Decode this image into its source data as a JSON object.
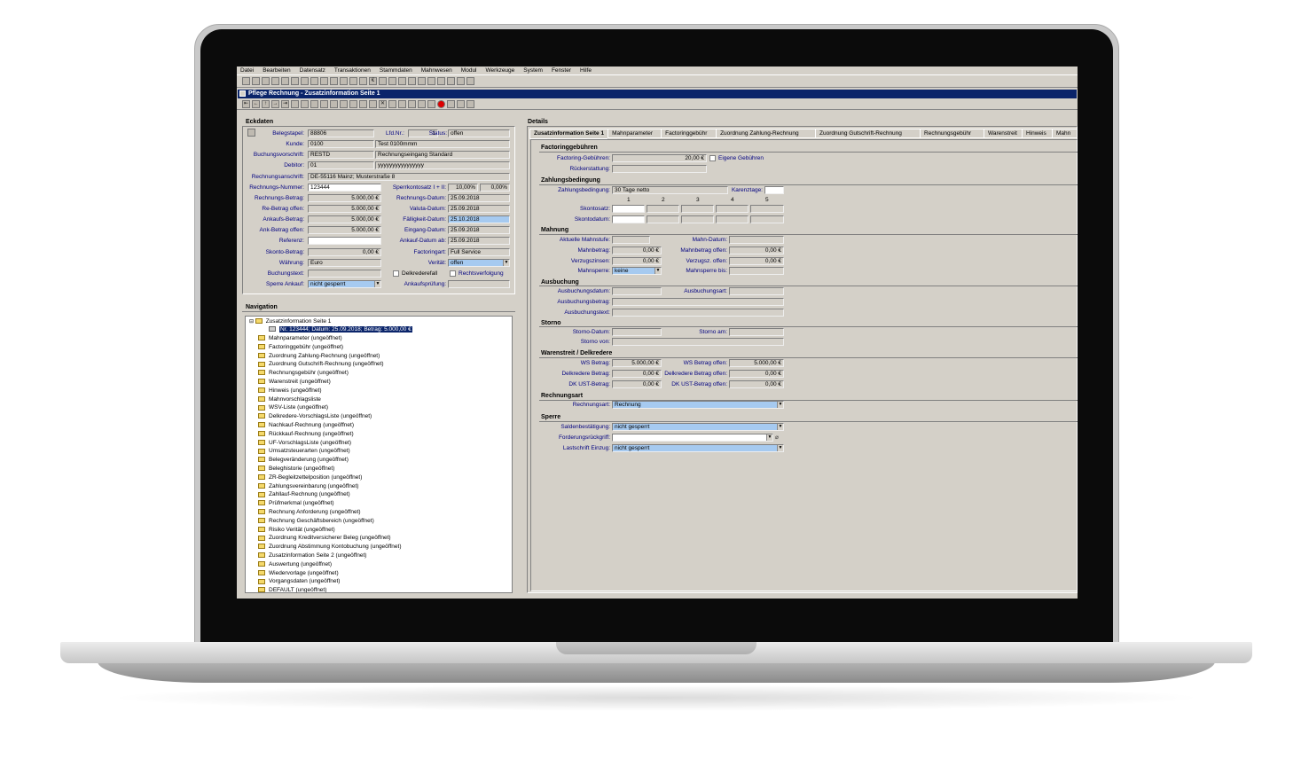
{
  "menu": [
    "Datei",
    "Bearbeiten",
    "Datensatz",
    "Transaktionen",
    "Stammdaten",
    "Mahnwesen",
    "Modul",
    "Werkzeuge",
    "System",
    "Fenster",
    "Hilfe"
  ],
  "window_title": "Pflege Rechnung - Zusatzinformation Seite 1",
  "eckdaten": {
    "title": "Eckdaten",
    "belegstapel_label": "Belegstapel:",
    "belegstapel": "88806",
    "lfdnr_label": "Lfd.Nr.:",
    "lfdnr": "1",
    "status_label": "Status:",
    "status": "offen",
    "kunde_label": "Kunde:",
    "kunde": "0100",
    "kunde_name": "Test 0100mmm",
    "buchungsvorschrift_label": "Buchungsvorschrift:",
    "buchungsvorschrift": "RESTD",
    "buchungsvorschrift_text": "Rechnungseingang Standard",
    "debitor_label": "Debitor:",
    "debitor": "01",
    "debitor_name": "yyyyyyyyyyyyyyyy",
    "anschrift_label": "Rechnungsanschrift:",
    "anschrift": "DE-55116 Mainz; Musterstraße 8",
    "rechnungsnummer_label": "Rechnungs-Nummer:",
    "rechnungsnummer": "123444",
    "sperrkontosatz_label": "Sperrkontosatz I + II:",
    "sperr1": "10,00%",
    "sperr2": "0,00%",
    "rechnungsbetrag_label": "Rechnungs-Betrag:",
    "rechnungsbetrag": "5.000,00 €",
    "rechnungsdatum_label": "Rechnungs-Datum:",
    "rechnungsdatum": "25.09.2018",
    "rebetrag_offen_label": "Re-Betrag offen:",
    "rebetrag_offen": "5.000,00 €",
    "valuta_label": "Valuta-Datum:",
    "valuta": "25.09.2018",
    "ankaufsbetrag_label": "Ankaufs-Betrag:",
    "ankaufsbetrag": "5.000,00 €",
    "faelligkeit_label": "Fälligkeit-Datum:",
    "faelligkeit": "25.10.2018",
    "ankbetrag_offen_label": "Ank-Betrag offen:",
    "ankbetrag_offen": "5.000,00 €",
    "eingang_label": "Eingang-Datum:",
    "eingang": "25.09.2018",
    "referenz_label": "Referenz:",
    "referenz": "",
    "ankaufdatum_label": "Ankauf-Datum ab:",
    "ankaufdatum": "25.09.2018",
    "skonto_label": "Skonto-Betrag:",
    "skonto": "0,00 €",
    "factoringart_label": "Factoringart:",
    "factoringart": "Full Service",
    "waehrung_label": "Währung:",
    "waehrung": "Euro",
    "veritaet_label": "Verität:",
    "veritaet": "offen",
    "buchungstext_label": "Buchungstext:",
    "buchungstext": "",
    "delkrederefall_label": "Delkrederefall",
    "rechtsverfolgung_label": "Rechtsverfolgung",
    "sperre_ankauf_label": "Sperre Ankauf:",
    "sperre_ankauf": "nicht gesperrt",
    "ankaufspruefung_label": "Ankaufsprüfung:",
    "ankaufspruefung": ""
  },
  "navigation": {
    "title": "Navigation",
    "root": "Zusatzinformation Seite 1",
    "selected": "Nr. 123444; Datum: 25.09.2018; Betrag: 5.000,00 €",
    "items": [
      "Mahnparameter (ungeöffnet)",
      "Factoringgebühr (ungeöffnet)",
      "Zuordnung Zahlung-Rechnung (ungeöffnet)",
      "Zuordnung Gutschrift-Rechnung (ungeöffnet)",
      "Rechnungsgebühr (ungeöffnet)",
      "Warenstreit (ungeöffnet)",
      "Hinweis (ungeöffnet)",
      "Mahnvorschlagsliste",
      "WSV-Liste (ungeöffnet)",
      "Delkredere-VorschlagsListe (ungeöffnet)",
      "Nachkauf-Rechnung (ungeöffnet)",
      "Rückkauf-Rechnung (ungeöffnet)",
      "UF-VorschlagsListe (ungeöffnet)",
      "Umsatzsteuerarten (ungeöffnet)",
      "Belegveränderung (ungeöffnet)",
      "Beleghistorie (ungeöffnet)",
      "ZR-Begleitzettelposition (ungeöffnet)",
      "Zahlungsvereinbarung (ungeöffnet)",
      "Zahllauf-Rechnung (ungeöffnet)",
      "Prüfmerkmal (ungeöffnet)",
      "Rechnung Anforderung (ungeöffnet)",
      "Rechnung Geschäftsbereich (ungeöffnet)",
      "Risiko Verität (ungeöffnet)",
      "Zuordnung Kreditversicherer Beleg (ungeöffnet)",
      "Zuordnung Abstimmung Kontobuchung (ungeöffnet)",
      "Zusatzinformation Seite 2 (ungeöffnet)",
      "Auswertung (ungeöffnet)",
      "Wiedervorlage (ungeöffnet)",
      "Vorgangsdaten (ungeöffnet)",
      "DEFAULT (ungeöffnet)"
    ]
  },
  "details": {
    "title": "Details",
    "tabs": [
      "Zusatzinformation Seite 1",
      "Mahnparameter",
      "Factoringgebühr",
      "Zuordnung Zahlung-Rechnung",
      "Zuordnung Gutschrift-Rechnung",
      "Rechnungsgebühr",
      "Warenstreit",
      "Hinweis",
      "Mahn"
    ],
    "factoring": {
      "title": "Factoringgebühren",
      "gebuehren_label": "Factoring-Gebühren:",
      "gebuehren": "20,00 €",
      "eigene_label": "Eigene Gebühren",
      "rueck_label": "Rückerstattung:",
      "rueck": ""
    },
    "zahlung": {
      "title": "Zahlungsbedingung",
      "bed_label": "Zahlungsbedingung:",
      "bed": "30 Tage netto",
      "karenz_label": "Karenztage:",
      "karenz": "",
      "cols": [
        "1",
        "2",
        "3",
        "4",
        "5"
      ],
      "skontosatz_label": "Skontosatz:",
      "skontodatum_label": "Skontodatum:"
    },
    "mahnung": {
      "title": "Mahnung",
      "stufe_label": "Aktuelle Mahnstufe:",
      "stufe": "",
      "mahndatum_label": "Mahn-Datum:",
      "mahndatum": "",
      "betrag_label": "Mahnbetrag:",
      "betrag": "0,00 €",
      "betrag_offen_label": "Mahnbetrag offen:",
      "betrag_offen": "0,00 €",
      "zinsen_label": "Verzugszinsen:",
      "zinsen": "0,00 €",
      "zinsen_offen_label": "Verzugsz. offen:",
      "zinsen_offen": "0,00 €",
      "sperre_label": "Mahnsperre:",
      "sperre": "keine",
      "sperre_bis_label": "Mahnsperre bis:",
      "sperre_bis": ""
    },
    "ausbuchung": {
      "title": "Ausbuchung",
      "datum_label": "Ausbuchungsdatum:",
      "art_label": "Ausbuchungsart:",
      "betrag_label": "Ausbuchungsbetrag:",
      "text_label": "Ausbuchungstext:"
    },
    "storno": {
      "title": "Storno",
      "datum_label": "Storno-Datum:",
      "am_label": "Storno am:",
      "von_label": "Storno von:"
    },
    "warenstreit": {
      "title": "Warenstreit / Delkredere",
      "ws_label": "WS Betrag:",
      "ws": "5.000,00 €",
      "ws_offen_label": "WS Betrag offen:",
      "ws_offen": "5.000,00 €",
      "dk_label": "Delkredere Betrag:",
      "dk": "0,00 €",
      "dk_offen_label": "Delkredere Betrag offen:",
      "dk_offen": "0,00 €",
      "ust_label": "DK UST-Betrag:",
      "ust": "0,00 €",
      "ust_offen_label": "DK UST-Betrag offen:",
      "ust_offen": "0,00 €"
    },
    "rechnungsart": {
      "title": "Rechnungsart",
      "label": "Rechnungsart:",
      "value": "Rechnung"
    },
    "sperre": {
      "title": "Sperre",
      "saldo_label": "Saldenbestätigung:",
      "saldo": "nicht gesperrt",
      "ford_label": "Forderungsrückgriff:",
      "ford": "",
      "last_label": "Lastschrift Einzug:",
      "last": "nicht gesperrt"
    }
  }
}
